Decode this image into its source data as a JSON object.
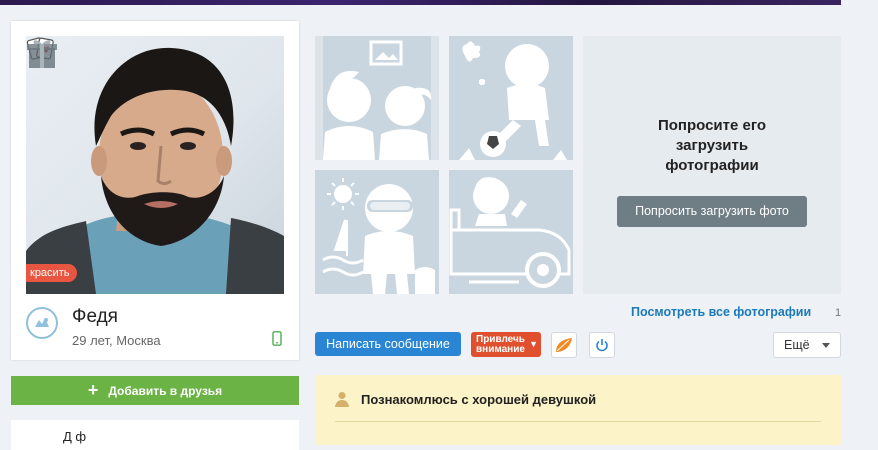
{
  "profile": {
    "name": "Федя",
    "meta": "29 лет, Москва",
    "decorate_label": "красить",
    "add_friend_label": "Добавить в друзья",
    "lower_card_fragment": "Д                  ф"
  },
  "photos": {
    "ask_title_line1": "Попросите его",
    "ask_title_line2": "загрузить",
    "ask_title_line3": "фотографии",
    "ask_button_label": "Попросить загрузить фото",
    "all_photos_label": "Посмотреть все фотографии",
    "count": "1"
  },
  "actions": {
    "message_label": "Написать сообщение",
    "attention_line1": "Привлечь",
    "attention_line2": "внимание",
    "more_label": "Ещё"
  },
  "status": {
    "text": "Познакомлюсь с хорошей девушкой"
  },
  "colors": {
    "accent_blue": "#2a86d4",
    "add_friend_green": "#6ab344",
    "attention_red": "#e0502f",
    "status_bg": "#fcf3c8"
  }
}
